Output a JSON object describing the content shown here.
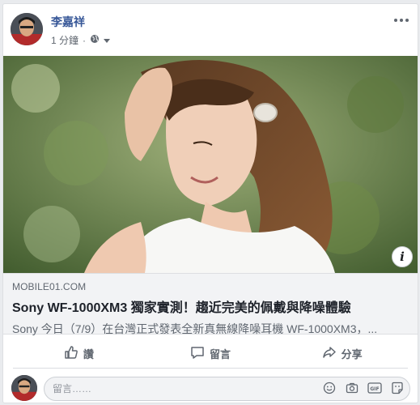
{
  "post": {
    "author": "李嘉祥",
    "time": "1 分鐘",
    "privacy_icon": "globe-icon"
  },
  "link": {
    "domain": "MOBILE01.COM",
    "title": "Sony WF-1000XM3 獨家實測！趨近完美的佩戴與降噪體驗",
    "description": "Sony 今日（7/9）在台灣正式發表全新真無線降噪耳機 WF-1000XM3，..."
  },
  "actions": {
    "like": "讚",
    "comment": "留言",
    "share": "分享"
  },
  "comment_box": {
    "placeholder": "留言……"
  },
  "colors": {
    "author_link": "#385898",
    "meta_gray": "#606770",
    "preview_bg": "#f2f3f5"
  }
}
